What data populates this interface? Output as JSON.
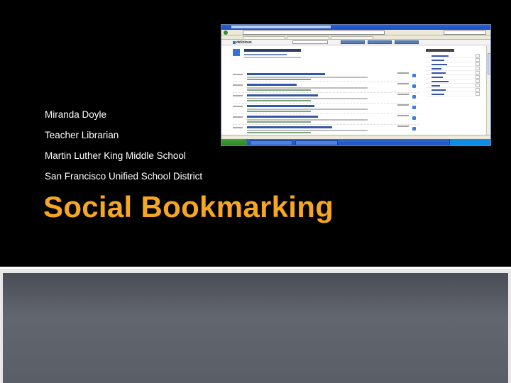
{
  "slide": {
    "author_lines": [
      "Miranda Doyle",
      "Teacher Librarian",
      "Martin Luther King Middle School",
      "San Francisco Unified School District"
    ],
    "title": "Social Bookmarking"
  },
  "colors": {
    "background": "#000000",
    "title": "#f5a623",
    "body_text": "#ffffff",
    "band": "#5a5e67"
  },
  "screenshot": {
    "logo_text": "delicious",
    "icon_names": [
      "start-icon",
      "delicious-logo-icon",
      "save-icon"
    ]
  }
}
